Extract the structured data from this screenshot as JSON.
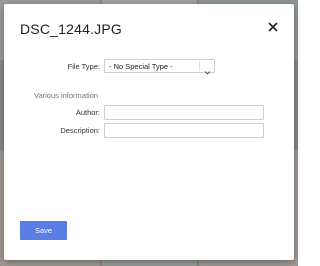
{
  "dialog": {
    "title": "DSC_1244.JPG",
    "close_icon": "close-icon"
  },
  "file_type": {
    "label": "File Type:",
    "selected": "- No Special Type -",
    "dropdown_icon": "chevron-down-icon"
  },
  "section": {
    "label": "Various information"
  },
  "author": {
    "label": "Author:",
    "value": "",
    "placeholder": ""
  },
  "description": {
    "label": "Description:",
    "value": "",
    "placeholder": ""
  },
  "actions": {
    "save_label": "Save"
  },
  "colors": {
    "accent": "#5b7ee5",
    "overlay": "#8a8a8a"
  }
}
